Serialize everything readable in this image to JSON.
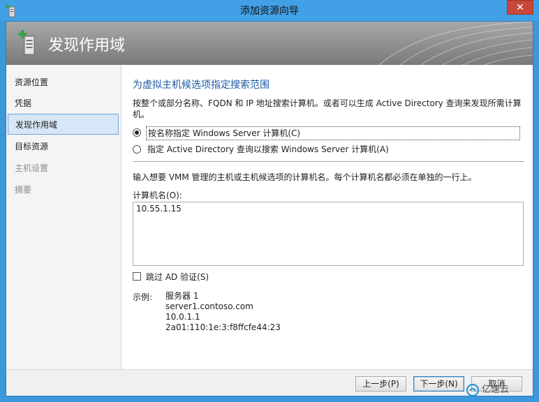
{
  "window": {
    "title": "添加资源向导",
    "close_glyph": "✕"
  },
  "banner": {
    "title": "发现作用域",
    "icon": "server-add-icon"
  },
  "sidebar": {
    "items": [
      {
        "label": "资源位置",
        "state": "normal"
      },
      {
        "label": "凭据",
        "state": "normal"
      },
      {
        "label": "发现作用域",
        "state": "active"
      },
      {
        "label": "目标资源",
        "state": "normal"
      },
      {
        "label": "主机设置",
        "state": "disabled"
      },
      {
        "label": "摘要",
        "state": "disabled"
      }
    ]
  },
  "main": {
    "heading": "为虚拟主机候选项指定搜索范围",
    "description": "按整个或部分名称、FQDN 和 IP 地址搜索计算机。或者可以生成 Active Directory 查询来发现所需计算机。",
    "radio_name": "按名称指定 Windows Server 计算机(C)",
    "radio_ad": "指定 Active Directory 查询以搜索 Windows Server 计算机(A)",
    "instruction": "输入想要 VMM 管理的主机或主机候选项的计算机名。每个计算机名都必须在单独的一行上。",
    "computer_names_label": "计算机名(O):",
    "computer_names_value": "10.55.1.15",
    "skip_ad_label": "跳过 AD 验证(S)",
    "example_label": "示例:",
    "examples": [
      "服务器 1",
      "server1.contoso.com",
      "10.0.1.1",
      "2a01:110:1e:3:f8ffcfe44:23"
    ]
  },
  "footer": {
    "prev": "上一步(P)",
    "next": "下一步(N)",
    "cancel": "取消"
  },
  "watermark": {
    "text": "亿速云"
  },
  "colors": {
    "heading": "#1c5aa3",
    "titlebar": "#42a0e6",
    "close": "#c7483b",
    "active_item": "#d6e7f7"
  }
}
